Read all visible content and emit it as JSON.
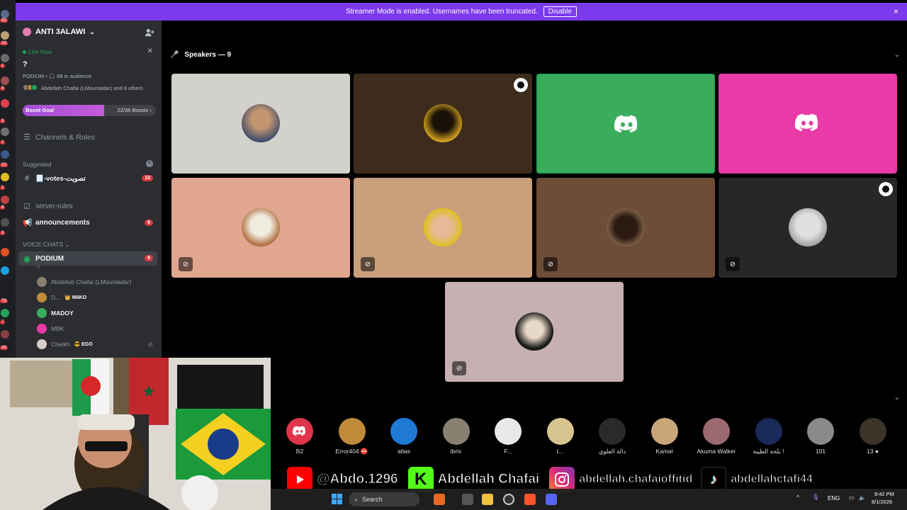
{
  "banner": {
    "message": "Streamer Mode is enabled. Usernames have been truncated.",
    "disable_label": "Disable",
    "close_icon": "×"
  },
  "rail": {
    "badges": [
      "52",
      "16",
      "1",
      "5",
      "3",
      "1",
      "23",
      "1",
      "9",
      "3",
      "78",
      "7",
      "9",
      "26"
    ]
  },
  "sidebar": {
    "server_name": "ANTI 3ALAWI",
    "live_now": "Live Now",
    "stage_topic": "?",
    "stage_meta": "PODIUM • 🎧 68 in audience",
    "stage_people": "Abdellah Chafai (LMountadar) and 8 others",
    "boost": {
      "label": "Boost Goal",
      "count": "22/36 Boosts ›",
      "fraction": 0.61
    },
    "channels_roles": "Channels & Roles",
    "suggested_label": "Suggested",
    "suggested_channel": "📃-votes-تصويت",
    "suggested_badge": "10",
    "server_rules": "server-rules",
    "announcements": "announcements",
    "announcements_badge": "6",
    "voice_category": "VOICE CHATS ⌄",
    "podium": "PODIUM",
    "podium_badge": "6",
    "podium_sub": "?",
    "members": [
      {
        "name": "Abdellah Chafai (LMountadar)",
        "tag": ""
      },
      {
        "name": "D...",
        "tag": "👑 M6KO"
      },
      {
        "name": "MADOY",
        "tag": ""
      },
      {
        "name": "MBK",
        "tag": ""
      },
      {
        "name": "Cheikh",
        "tag": "😎 EGO"
      }
    ]
  },
  "stage": {
    "speakers_label": "Speakers — 9",
    "colors": {
      "tile1": "#d3d1cb",
      "tile2": "#3d2c1b",
      "tile3": "#3aad5a",
      "tile4": "#ea3aa8",
      "tile5": "#e0a690",
      "tile6": "#c99f7c",
      "tile7": "#6d4c38",
      "tile8": "#272727",
      "tile9": "#c7b0b1"
    }
  },
  "audience": [
    {
      "name": "B2",
      "color": "#e0344b"
    },
    {
      "name": "Error404 ⛔",
      "color": "#c08a3a"
    },
    {
      "name": "atlas",
      "color": "#1f7ad6"
    },
    {
      "name": "ibrix",
      "color": "#8a8070"
    },
    {
      "name": "F...",
      "color": "#e8e8e8"
    },
    {
      "name": "t...",
      "color": "#d8c48e"
    },
    {
      "name": "دالة العلوي",
      "color": "#2a2a2a"
    },
    {
      "name": "Kamal",
      "color": "#c9a57a"
    },
    {
      "name": "Akuma Walker",
      "color": "#9a6a70"
    },
    {
      "name": "بلحة الطيبة !",
      "color": "#1a2a5a"
    },
    {
      "name": "101",
      "color": "#8a8a8a"
    },
    {
      "name": "13 ●",
      "color": "#3a3528"
    }
  ],
  "social": {
    "youtube": "@Abdo.1296",
    "kick": "Abdellah Chafai",
    "instagram": "abdellah.chafaioffitid",
    "tiktok": "abdellahctafi44"
  },
  "taskbar": {
    "search": "Search",
    "lang": "ENG",
    "time": "9:42 PM",
    "date": "8/1/2026"
  }
}
